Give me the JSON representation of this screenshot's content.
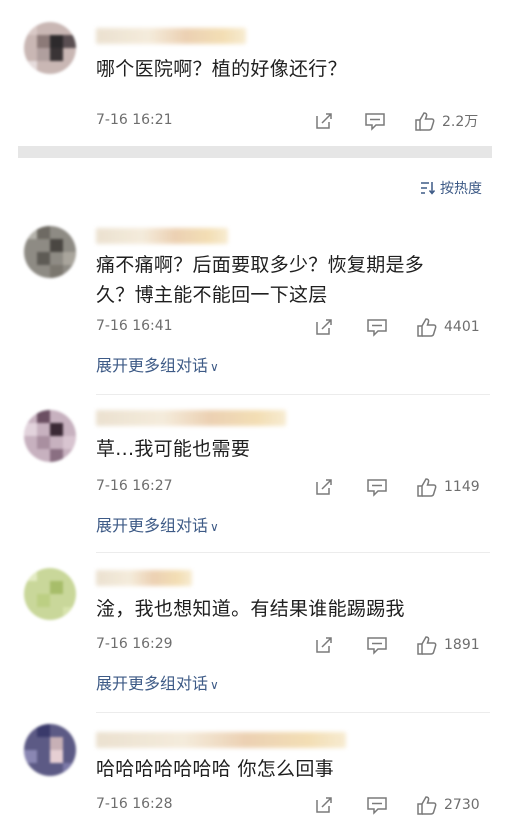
{
  "top_comment": {
    "text": "哪个医院啊？植的好像还行？",
    "time": "7-16 16:21",
    "likes": "2.2万"
  },
  "sort": {
    "label": "按热度"
  },
  "comments": [
    {
      "text": "痛不痛啊？后面要取多少？恢复期是多久？博主能不能回一下这层",
      "time": "7-16 16:41",
      "likes": "4401",
      "expand": "展开更多组对话"
    },
    {
      "text": "草...我可能也需要",
      "time": "7-16 16:27",
      "likes": "1149",
      "expand": "展开更多组对话"
    },
    {
      "text": "淦，我也想知道。有结果谁能踢踢我",
      "time": "7-16 16:29",
      "likes": "1891",
      "expand": "展开更多组对话"
    },
    {
      "text": "哈哈哈哈哈哈哈 你怎么回事",
      "time": "7-16 16:28",
      "likes": "2730"
    }
  ],
  "colors": {
    "link": "#3d5a86",
    "meta": "#6e6e6e"
  },
  "icons": [
    "forward-icon",
    "comment-icon",
    "like-icon",
    "sort-icon",
    "chevron-down-icon"
  ]
}
